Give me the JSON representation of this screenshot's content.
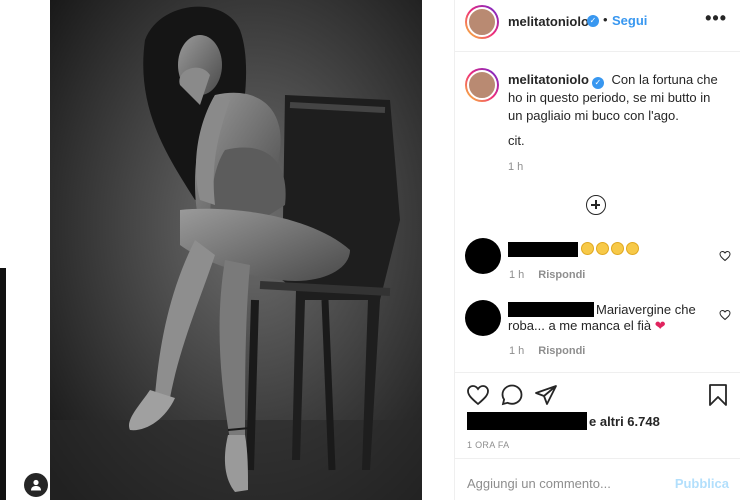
{
  "post": {
    "username": "melitatoniolo",
    "follow_label": "Segui",
    "dot": "•",
    "more_label": "•••"
  },
  "caption": {
    "username": "melitatoniolo",
    "text": "Con la fortuna che ho in questo periodo, se mi butto in un pagliaio mi buco con l'ago.",
    "cit": "cit.",
    "time": "1 h"
  },
  "comments": [
    {
      "text": "",
      "emojis": 4,
      "time": "1 h",
      "reply_label": "Rispondi"
    },
    {
      "text": "Mariavergine che roba... a me manca el fià",
      "time": "1 h",
      "reply_label": "Rispondi"
    }
  ],
  "likes": {
    "text": "e altri 6.748"
  },
  "post_time": "1 ORA FA",
  "add_comment": {
    "placeholder": "Aggiungi un commento...",
    "publish_label": "Pubblica"
  },
  "icons": {
    "verified": "verified-badge-icon",
    "more": "more-options-icon",
    "load_more": "plus-circle-icon",
    "like": "heart-icon",
    "comment": "comment-icon",
    "share": "paper-plane-icon",
    "save": "bookmark-icon",
    "user_tag": "user-tag-icon"
  },
  "colors": {
    "link": "#3897f0",
    "publish_disabled": "#b2dffc",
    "muted": "#8e8e8e",
    "heart": "#e0245e"
  }
}
